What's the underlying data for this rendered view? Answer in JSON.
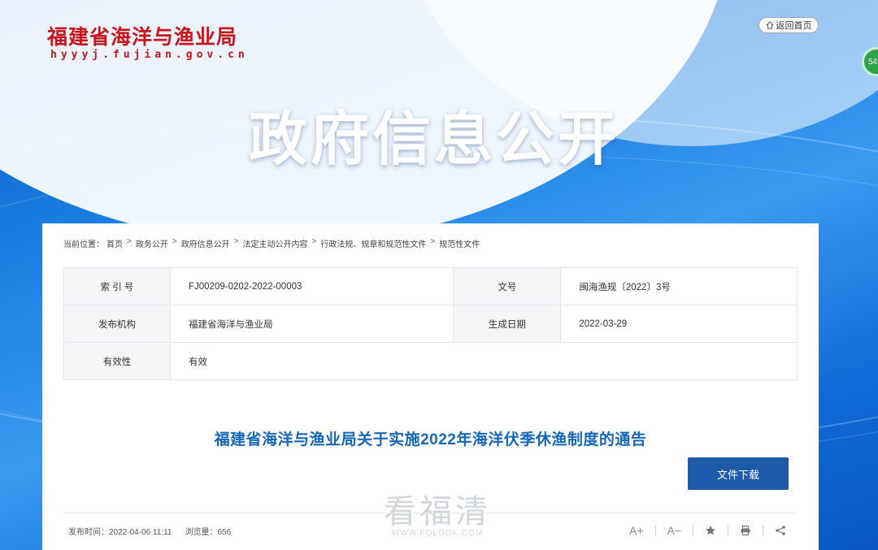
{
  "header": {
    "logo_cn": "福建省海洋与渔业局",
    "logo_url": "hyyyj.fujian.gov.cn",
    "home_label": "返回首页",
    "badge_text": "54",
    "hero_title": "政府信息公开"
  },
  "breadcrumb": {
    "prefix": "当前位置：",
    "items": [
      "首页",
      "政务公开",
      "政府信息公开",
      "法定主动公开内容",
      "行政法规、规章和规范性文件",
      "规范性文件"
    ]
  },
  "meta": {
    "index_label": "索 引 号",
    "index_value": "FJ00209-0202-2022-00003",
    "doc_no_label": "文号",
    "doc_no_value": "闽海渔规〔2022〕3号",
    "publisher_label": "发布机构",
    "publisher_value": "福建省海洋与渔业局",
    "date_label": "生成日期",
    "date_value": "2022-03-29",
    "validity_label": "有效性",
    "validity_value": "有效"
  },
  "article": {
    "title": "福建省海洋与渔业局关于实施2022年海洋伏季休渔制度的通告",
    "download_label": "文件下载",
    "publish_time": "发布时间：2022-04-06 11:11",
    "views": "浏览量：656"
  },
  "watermark": {
    "text": "看福清",
    "url": "WWW.FQLOOK.COM"
  },
  "tools": {
    "font_up": "A+",
    "font_down": "A−"
  },
  "colors": {
    "brand_red": "#c8161d",
    "title_blue": "#1567b8",
    "button_blue": "#1f5aa8"
  }
}
